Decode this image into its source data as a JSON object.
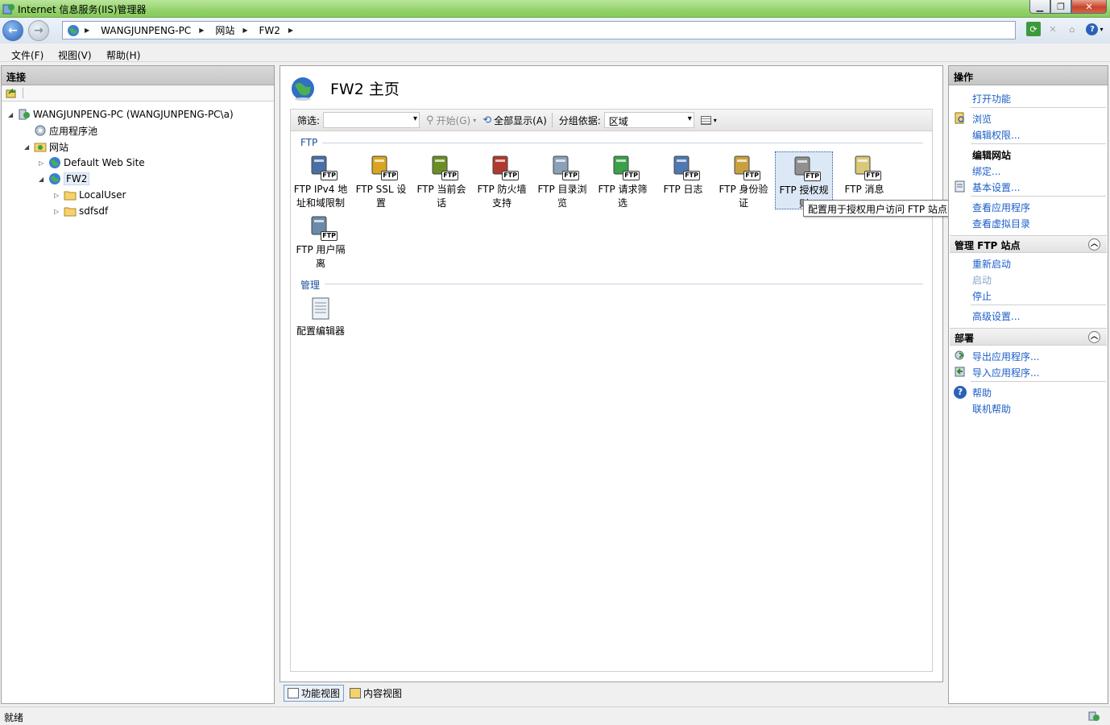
{
  "window": {
    "title": "Internet 信息服务(IIS)管理器"
  },
  "address": {
    "crumbs": [
      "WANGJUNPENG-PC",
      "网站",
      "FW2"
    ]
  },
  "menu": [
    "文件(F)",
    "视图(V)",
    "帮助(H)"
  ],
  "connections": {
    "header": "连接",
    "tree": [
      {
        "label": "WANGJUNPENG-PC (WANGJUNPENG-PC\\a)",
        "level": 0
      },
      {
        "label": "应用程序池",
        "level": 1
      },
      {
        "label": "网站",
        "level": 1
      },
      {
        "label": "Default Web Site",
        "level": 2
      },
      {
        "label": "FW2",
        "level": 2
      },
      {
        "label": "LocalUser",
        "level": 3
      },
      {
        "label": "sdfsdf",
        "level": 3
      }
    ]
  },
  "main": {
    "title": "FW2 主页",
    "filter": {
      "label": "筛选:",
      "start": "开始(G)",
      "show_all": "全部显示(A)",
      "group_by_label": "分组依据:",
      "group_by_value": "区域"
    },
    "groups": [
      {
        "name": "FTP",
        "features": [
          "FTP IPv4 地址和域限制",
          "FTP SSL 设置",
          "FTP 当前会话",
          "FTP 防火墙支持",
          "FTP 目录浏览",
          "FTP 请求筛选",
          "FTP 日志",
          "FTP 身份验证",
          "FTP 授权规则",
          "FTP 消息",
          "FTP 用户隔离"
        ]
      },
      {
        "name": "管理",
        "features": [
          "配置编辑器"
        ]
      }
    ],
    "tooltip": "配置用于授权用户访问 FTP 站点的规则",
    "view_tabs": [
      "功能视图",
      "内容视图"
    ]
  },
  "actions": {
    "header": "操作",
    "items": {
      "open_feature": "打开功能",
      "browse": "浏览",
      "edit_permissions": "编辑权限...",
      "edit_site": "编辑网站",
      "bindings": "绑定...",
      "basic_settings": "基本设置...",
      "view_apps": "查看应用程序",
      "view_vdirs": "查看虚拟目录"
    },
    "manage_section": {
      "title": "管理 FTP 站点",
      "restart": "重新启动",
      "start": "启动",
      "stop": "停止",
      "advanced": "高级设置..."
    },
    "deploy_section": {
      "title": "部署",
      "export_app": "导出应用程序...",
      "import_app": "导入应用程序..."
    },
    "help": "帮助",
    "online_help": "联机帮助"
  },
  "status": {
    "text": "就绪"
  },
  "colors": {
    "title_bar": "#93d36b",
    "link": "#1c5ec7",
    "group_head": "#1a4f9b"
  }
}
